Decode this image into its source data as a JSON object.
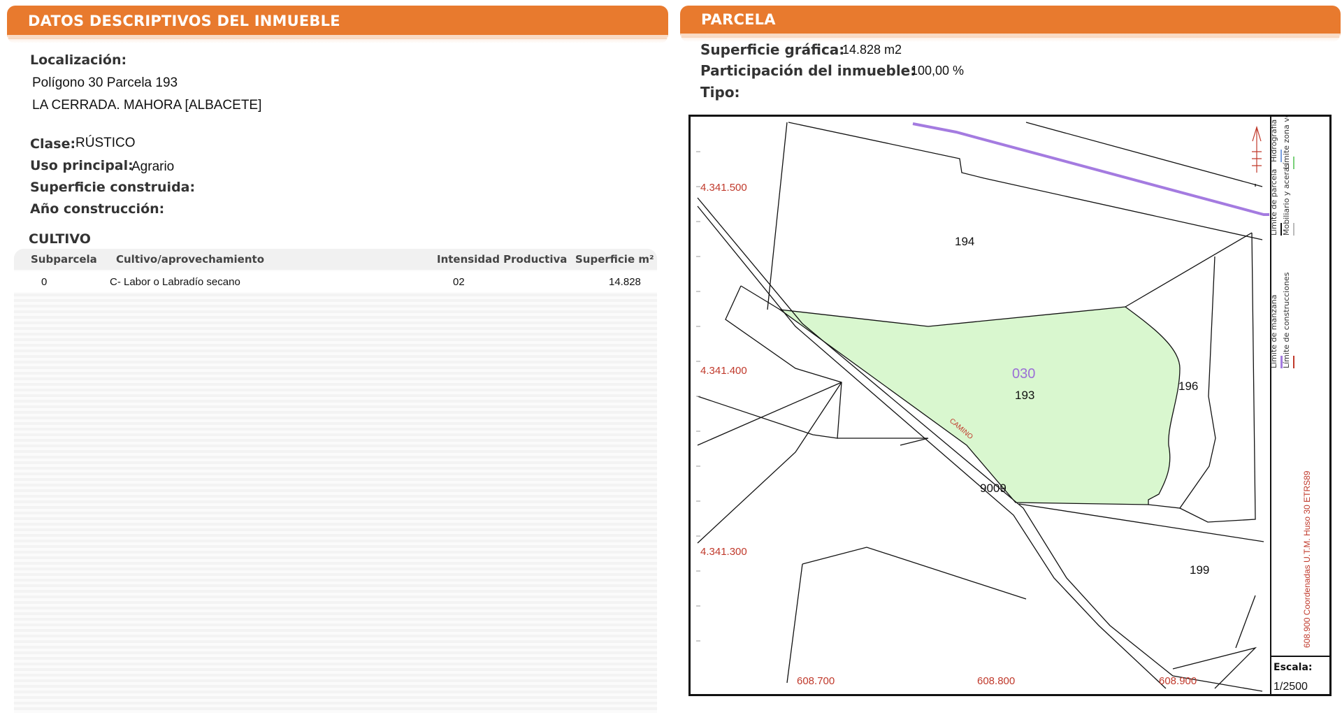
{
  "left_section": {
    "title": "DATOS DESCRIPTIVOS DEL INMUEBLE",
    "localizacion_label": "Localización:",
    "localizacion_line1": "Polígono 30 Parcela 193",
    "localizacion_line2": "LA CERRADA. MAHORA [ALBACETE]",
    "clase_label": "Clase:",
    "clase_value": "RÚSTICO",
    "uso_label": "Uso principal:",
    "uso_value": "Agrario",
    "superficie_construida_label": "Superficie construida:",
    "anio_label": "Año construcción:"
  },
  "cultivo": {
    "title": "CULTIVO",
    "columns": [
      "Subparcela",
      "Cultivo/aprovechamiento",
      "Intensidad Productiva",
      "Superficie m²"
    ],
    "rows": [
      [
        "0",
        "C- Labor o Labradío secano",
        "02",
        "14.828"
      ]
    ]
  },
  "right_section": {
    "title": "PARCELA",
    "superficie_grafica_label": "Superficie gráfica:",
    "superficie_grafica_value": "14.828 m2",
    "participacion_label": "Participación del inmueble:",
    "participacion_value": "100,00 %",
    "tipo_label": "Tipo:"
  },
  "map": {
    "y_coords": [
      "4.341.500",
      "4.341.400",
      "4.341.300"
    ],
    "x_coords": [
      "608.700",
      "608.800",
      "608.900"
    ],
    "parcels": [
      "194",
      "193",
      "196",
      "199",
      "9009"
    ],
    "polygon_label": "030",
    "road_label": "CAMINO",
    "scale_label": "Escala:",
    "scale_value": "1/2500",
    "utm_note": "608.900 Coordenadas U.T.M. Huso 30 ETRS89",
    "legend": [
      "Límite de manzana",
      "Límite de parcela",
      "Hidrografía",
      "Límite de construcciones",
      "Mobiliario y aceras",
      "Límite zona verde"
    ],
    "colors": {
      "parcel_fill": "#d9f7cf",
      "hydro": "#a47be0",
      "coords": "#c0392b",
      "header": "#e87a2e"
    }
  }
}
